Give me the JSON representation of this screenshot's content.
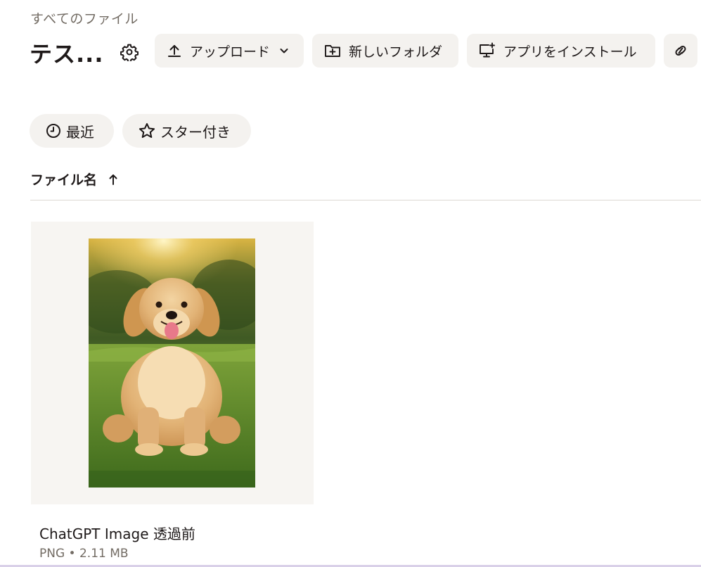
{
  "breadcrumb": "すべてのファイル",
  "folder": {
    "title": "テス..."
  },
  "toolbar": {
    "upload_label": "アップロード",
    "new_folder_label": "新しいフォルダ",
    "install_app_label": "アプリをインストール"
  },
  "filters": {
    "recent_label": "最近",
    "starred_label": "スター付き"
  },
  "list": {
    "sort_column_label": "ファイル名",
    "sort_direction": "ascending"
  },
  "files": [
    {
      "name": "ChatGPT Image 透過前",
      "meta": "PNG • 2.11 MB",
      "thumbnail": "golden-retriever-photo"
    }
  ],
  "icons": {
    "settings": "gear-icon",
    "upload": "upload-arrow-icon",
    "dropdown": "chevron-down-icon",
    "new_folder": "folder-plus-icon",
    "install": "monitor-plus-icon",
    "link": "link-icon",
    "recent": "clock-icon",
    "starred": "star-icon",
    "sort": "arrow-up-icon"
  },
  "colors": {
    "text_primary": "#1e1919",
    "text_secondary": "#736c64",
    "button_bg": "#f4f2ef",
    "divider": "#dcd8d3"
  }
}
